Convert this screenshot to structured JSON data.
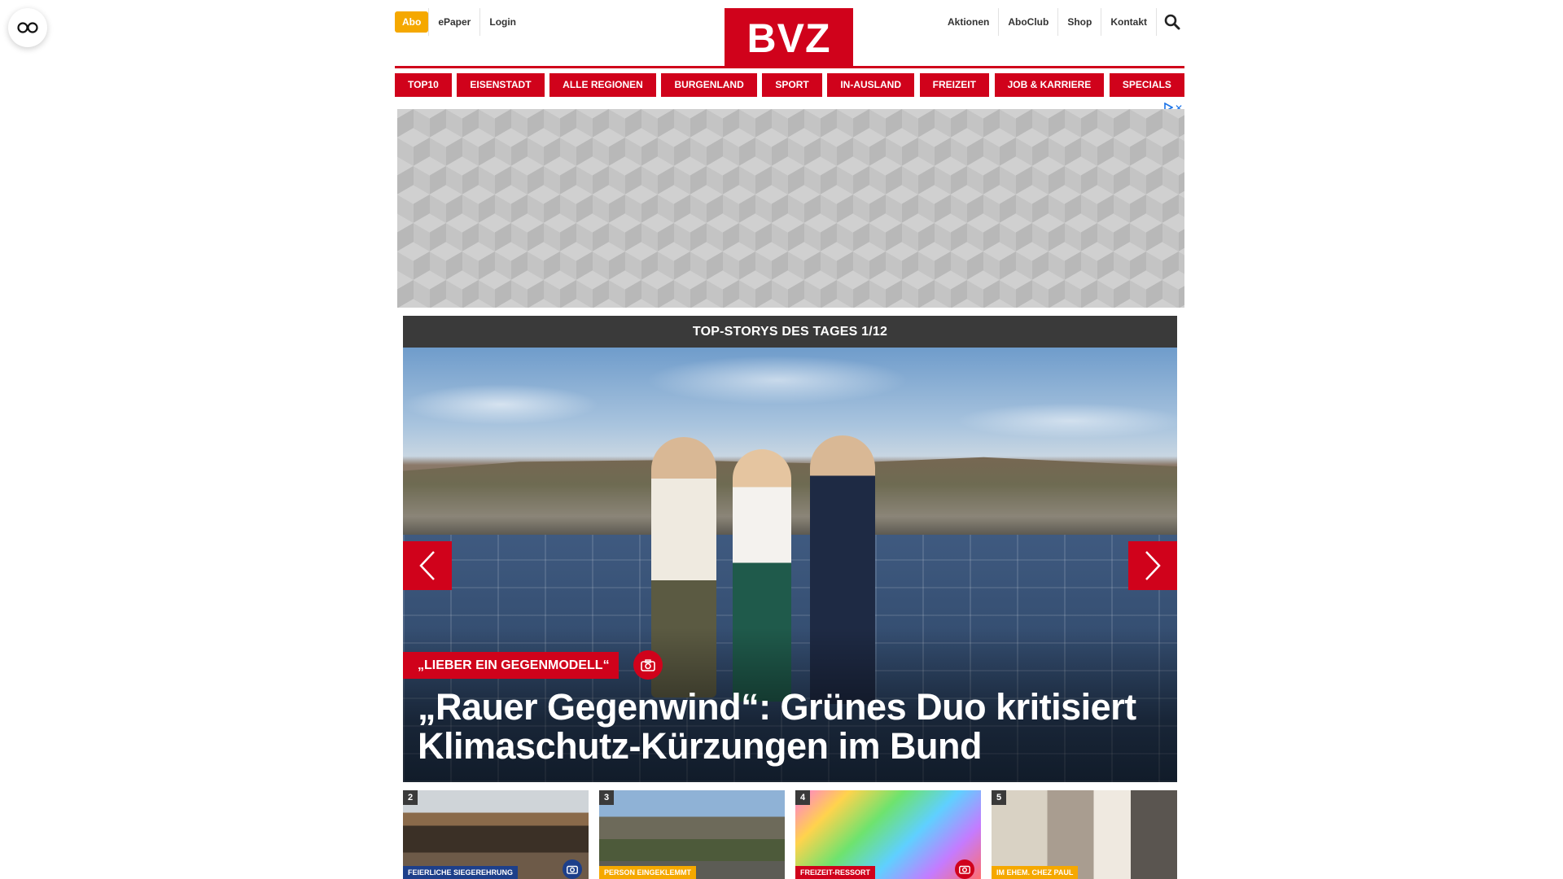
{
  "header": {
    "abo_label": "Abo",
    "epaper_label": "ePaper",
    "login_label": "Login",
    "logo_text": "BVZ",
    "right_links": [
      "Aktionen",
      "AboClub",
      "Shop",
      "Kontakt"
    ]
  },
  "nav": {
    "items": [
      "TOP10",
      "EISENSTADT",
      "ALLE REGIONEN",
      "BURGENLAND",
      "SPORT",
      "IN-AUSLAND",
      "FREIZEIT",
      "JOB & KARRIERE",
      "SPECIALS"
    ]
  },
  "ad": {
    "badge_icon": "adchoices-icon",
    "close_glyph": "✕"
  },
  "stories": {
    "heading": "TOP-STORYS DES TAGES 1/12",
    "hero": {
      "kicker": "„LIEBER EIN GEGENMODELL“",
      "title": "„Rauer Gegenwind“: Grünes Duo kritisiert Klimaschutz-Kürzungen im Bund"
    },
    "thumbs": [
      {
        "num": "2",
        "tag": "FEIERLICHE SIEGEREHRUNG",
        "tag_color": "#1d3f8a",
        "camera": true
      },
      {
        "num": "3",
        "tag": "PERSON EINGEKLEMMT",
        "tag_color": "#f5a800",
        "camera": false
      },
      {
        "num": "4",
        "tag": "FREIZEIT-RESSORT",
        "tag_color": "#d0021b",
        "camera": true
      },
      {
        "num": "5",
        "tag": "IM EHEM. CHEZ PAUL",
        "tag_color": "#f5a800",
        "camera": false
      }
    ]
  },
  "colors": {
    "brand_red": "#d0021b",
    "abo_orange": "#f5a800",
    "dark_bar": "#3a3a3a"
  }
}
